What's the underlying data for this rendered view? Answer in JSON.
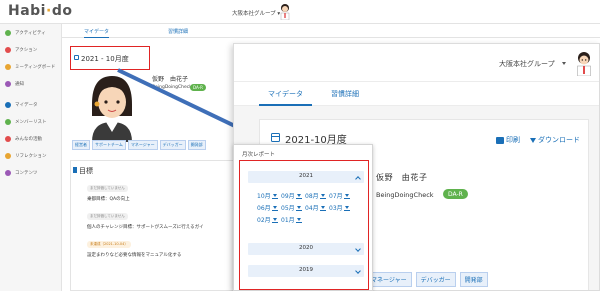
{
  "background": {
    "logo": "Habi do",
    "org_label": "大阪本社グループ ▾",
    "sidebar": [
      {
        "label": "アクティビティ",
        "color": "#5fb24d"
      },
      {
        "label": "アクション",
        "color": "#e24c4c"
      },
      {
        "label": "ミーティングボード",
        "color": "#e8a532"
      },
      {
        "label": "通知",
        "color": "#9b59b6"
      },
      {
        "label": "マイデータ",
        "color": "#1a6fb7"
      },
      {
        "label": "メンバーリスト",
        "color": "#5fb24d"
      },
      {
        "label": "みんなの活動",
        "color": "#e24c4c"
      },
      {
        "label": "リフレクション",
        "color": "#e8a532"
      },
      {
        "label": "コンテンツ",
        "color": "#9b59b6"
      }
    ],
    "tabs": [
      "マイデータ",
      "習慣詳細"
    ],
    "date": "2021 - 10月度",
    "profile": {
      "name": "仮野　由花子",
      "sub": "BeingDoingCheck",
      "badge": "DA-R"
    },
    "tags": [
      "経営者",
      "サポートチーム",
      "マネージャー",
      "デバッガー",
      "開発部"
    ],
    "goals": {
      "title": "目標",
      "items": [
        {
          "pill": "まだ評価していません",
          "pill_style": "gray",
          "text": "乗都目標：QAの向上"
        },
        {
          "pill": "まだ評価していません",
          "pill_style": "gray",
          "text": "個人のチャレンジ目標：サポートがスムーズに行えるガイ"
        },
        {
          "pill": "未達成（2021-10-04）",
          "pill_style": "orange",
          "text": "設定まわりなど必要な情報をマニュアル化する"
        }
      ]
    }
  },
  "foreground": {
    "org_label": "大阪本社グループ",
    "tabs": [
      "マイデータ",
      "習慣詳細"
    ],
    "date": "2021-10月度",
    "print_label": "印刷",
    "download_label": "ダウンロード",
    "profile": {
      "name": "仮野　由花子",
      "sub": "BeingDoingCheck",
      "badge": "DA-R"
    },
    "tags": [
      "マネージャー",
      "デバッガー",
      "開発部"
    ]
  },
  "report": {
    "title": "月次レポート",
    "years": [
      {
        "label": "2021",
        "expanded": true,
        "months": [
          "10月",
          "09月",
          "08月",
          "07月",
          "06月",
          "05月",
          "04月",
          "03月",
          "02月",
          "01月"
        ]
      },
      {
        "label": "2020",
        "expanded": false,
        "months": []
      },
      {
        "label": "2019",
        "expanded": false,
        "months": []
      }
    ]
  },
  "colors": {
    "accent": "#1a6fb7",
    "highlight": "#e02424",
    "badge": "#5fb24d"
  }
}
